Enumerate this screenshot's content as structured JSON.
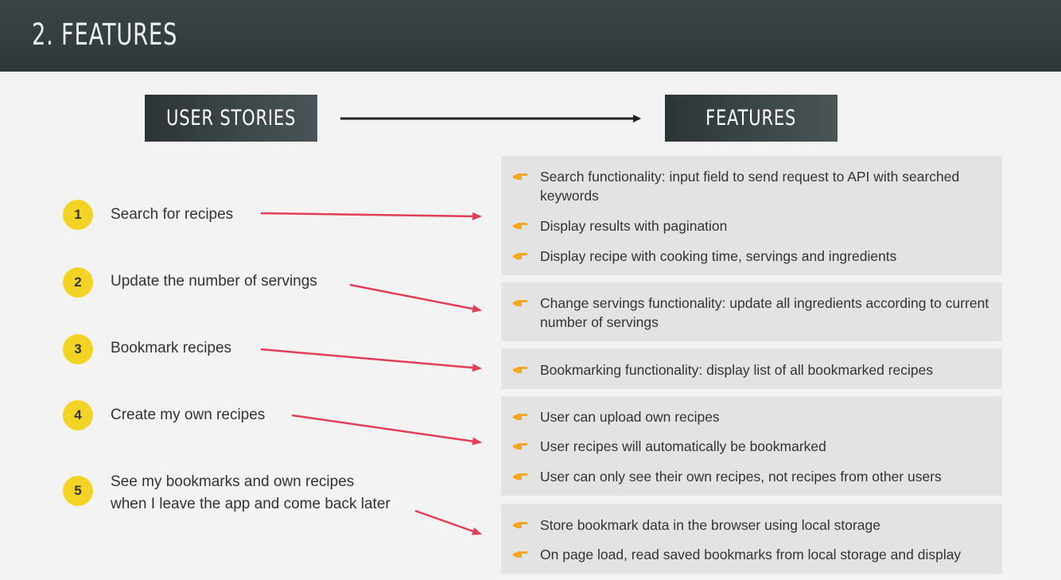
{
  "slide": {
    "title": "2. FEATURES"
  },
  "headers": {
    "left": "USER STORIES",
    "right": "FEATURES"
  },
  "colors": {
    "accent_yellow": "#f3d324",
    "arrow_red": "#e23e57",
    "icon_orange": "#f5a623",
    "dark": "#2f3839"
  },
  "stories": [
    {
      "number": "1",
      "text": "Search for recipes"
    },
    {
      "number": "2",
      "text": "Update the number of servings"
    },
    {
      "number": "3",
      "text": "Bookmark recipes"
    },
    {
      "number": "4",
      "text": "Create my own recipes"
    },
    {
      "number": "5",
      "text_line1": "See my bookmarks and own recipes",
      "text_line2": "when I leave the app and come back later"
    }
  ],
  "feature_groups": [
    {
      "items": [
        "Search functionality: input field to send request to API with searched keywords",
        "Display results with pagination",
        "Display recipe with cooking time, servings and ingredients"
      ]
    },
    {
      "items": [
        "Change servings functionality: update all ingredients according to current number of servings"
      ]
    },
    {
      "items": [
        "Bookmarking functionality: display list of all bookmarked recipes"
      ]
    },
    {
      "items": [
        "User can upload own recipes",
        "User recipes will automatically be bookmarked",
        "User can only see their own recipes, not recipes from other users"
      ]
    },
    {
      "items": [
        "Store bookmark data in the browser using local storage",
        "On page load, read saved bookmarks from local storage and display"
      ]
    }
  ],
  "icon": "pointing-hand-icon"
}
